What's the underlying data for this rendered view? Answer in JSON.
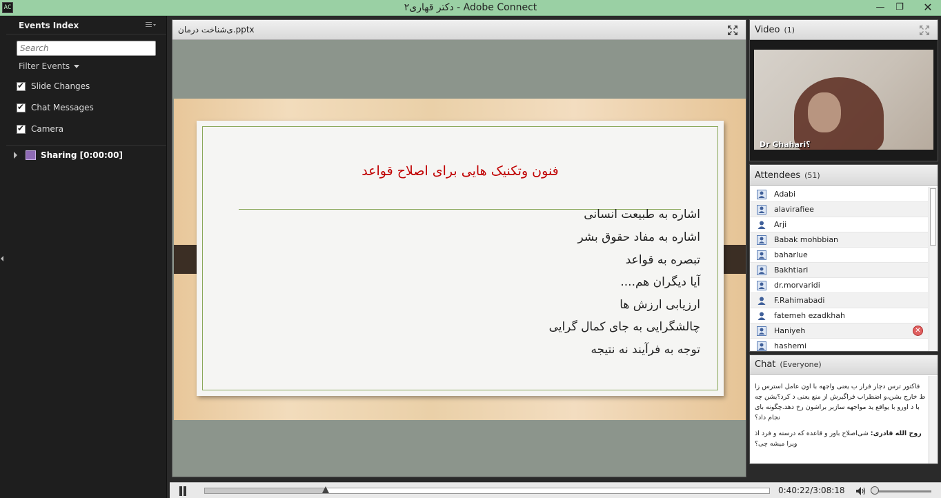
{
  "window": {
    "title": "دکتر قهاری۲ - Adobe Connect",
    "app_icon": "AC",
    "minimize": "—",
    "maximize": "❐",
    "close": "✕"
  },
  "events": {
    "title": "Events Index",
    "search_placeholder": "Search",
    "filter_label": "Filter Events",
    "filters": [
      {
        "label": "Slide Changes",
        "checked": true
      },
      {
        "label": "Chat Messages",
        "checked": true
      },
      {
        "label": "Camera",
        "checked": true
      }
    ],
    "sharing_label": "Sharing [0:00:00]"
  },
  "share": {
    "title": "ی‌شناخت درمان.pptx",
    "slide": {
      "title": "فنون وتکنیک هایی برای اصلاح قواعد",
      "bullets": [
        "اشاره به طبیعت انسانی",
        "اشاره به مفاد حقوق بشر",
        "تبصره به قواعد",
        "آیا دیگران هم....",
        "ارزیابی ارزش ها",
        "چالشگرایی به جای کمال گرایی",
        "توجه به فرآیند نه نتیجه"
      ]
    }
  },
  "video": {
    "title": "Video",
    "count": "(1)",
    "presenter_name": "Dr Ghahari؟"
  },
  "attendees": {
    "title": "Attendees",
    "count": "(51)",
    "list": [
      {
        "name": "Adabi",
        "role": "host"
      },
      {
        "name": "alavirafiee",
        "role": "host"
      },
      {
        "name": "Arji",
        "role": "participant"
      },
      {
        "name": "Babak mohbbian",
        "role": "host"
      },
      {
        "name": "baharlue",
        "role": "host"
      },
      {
        "name": "Bakhtiari",
        "role": "host"
      },
      {
        "name": "dr.morvaridi",
        "role": "host"
      },
      {
        "name": "F.Rahimabadi",
        "role": "participant"
      },
      {
        "name": "fatemeh ezadkhah",
        "role": "participant"
      },
      {
        "name": "Haniyeh",
        "role": "host"
      },
      {
        "name": "hashemi",
        "role": "host"
      }
    ],
    "remove_glyph": "✕"
  },
  "chat": {
    "title": "Chat",
    "scope": "(Everyone)",
    "messages": [
      {
        "sender": "",
        "text": "فاکتور ترس دچار فرار ب یعنی واجهه با اون عامل استرس زا ط خارج بشن،و اضطراب فراگیرش از منع یعنی د کرد؟یشن چه با د اورو با یواقع ید مواجهه سازبر براشون رخ دهد.چگونه بای نجام داد؟"
      },
      {
        "sender": "روح الله قادری:",
        "text": "شی‌اصلاح باور و قاعده که درسته و فرد اذ ویرا میشه چی؟"
      }
    ]
  },
  "playback": {
    "time": "0:40:22/3:08:18",
    "progress": 0.2144
  }
}
